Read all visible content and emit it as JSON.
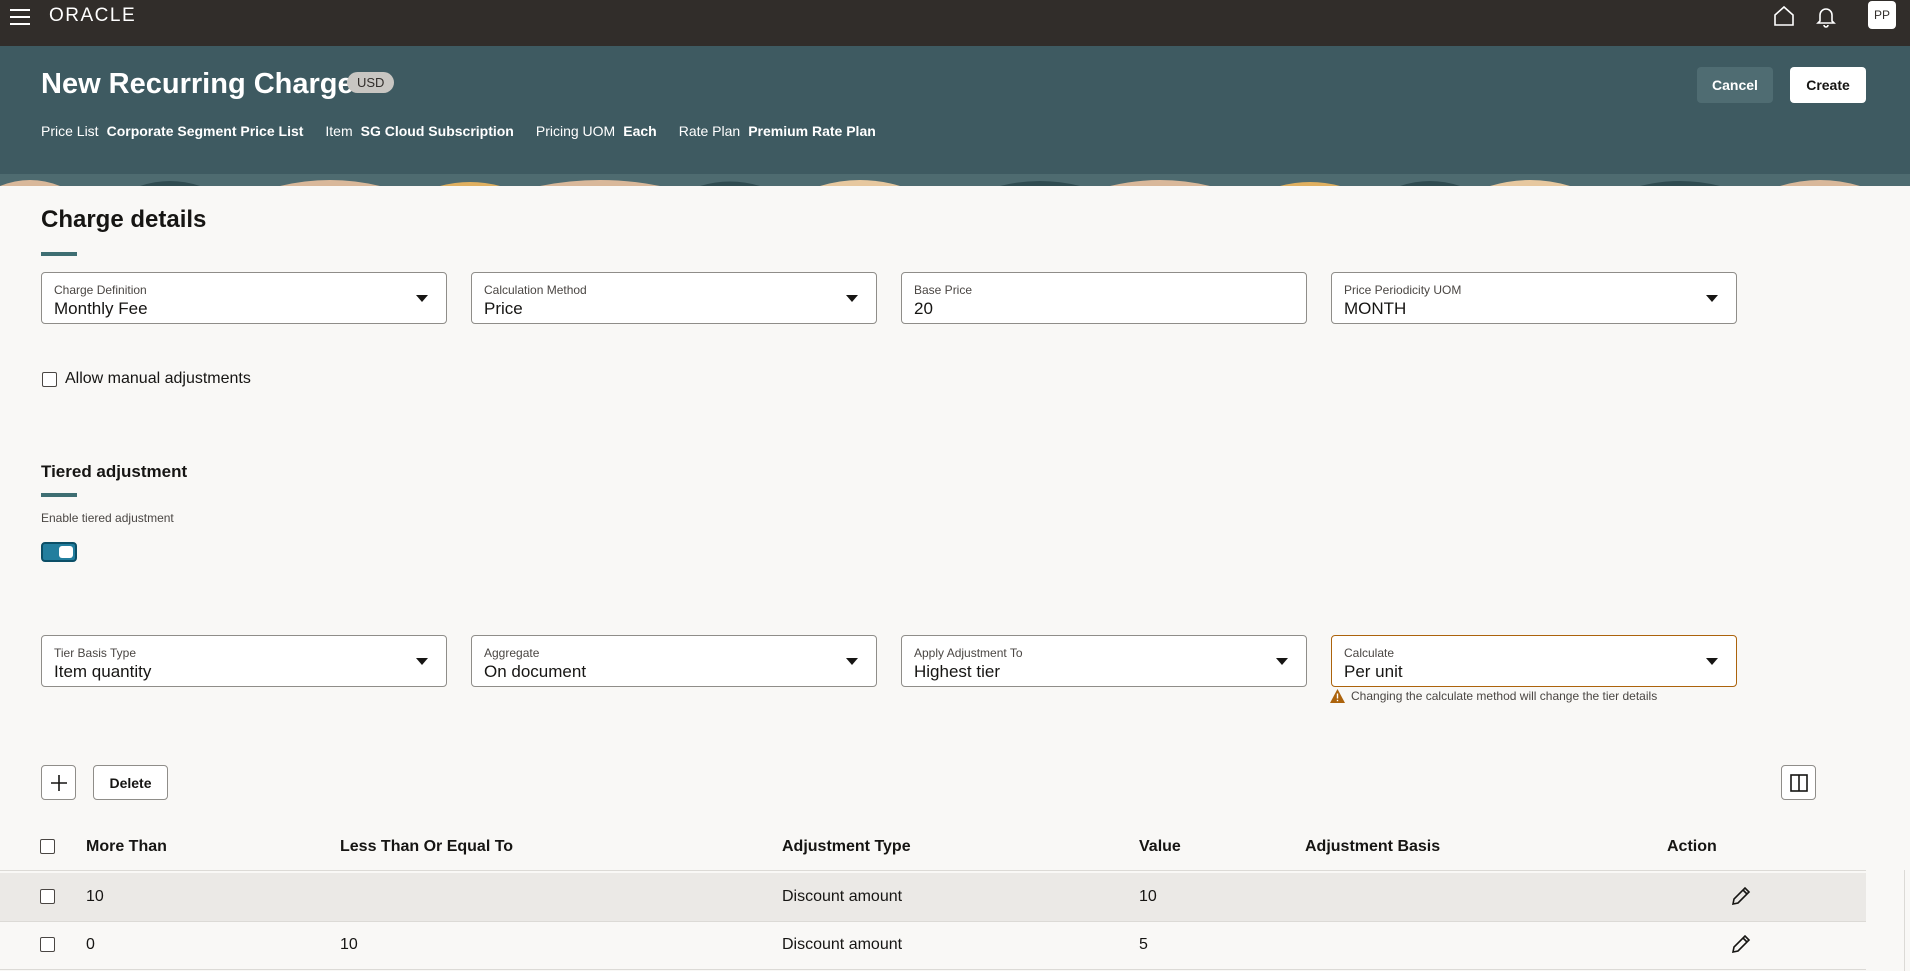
{
  "app": {
    "logo": "ORACLE",
    "avatar_initials": "PP"
  },
  "header": {
    "title": "New Recurring Charge",
    "currency": "USD",
    "meta": [
      {
        "label": "Price List",
        "value": "Corporate Segment Price List"
      },
      {
        "label": "Item",
        "value": "SG Cloud Subscription"
      },
      {
        "label": "Pricing UOM",
        "value": "Each"
      },
      {
        "label": "Rate Plan",
        "value": "Premium Rate Plan"
      }
    ],
    "cancel_label": "Cancel",
    "create_label": "Create"
  },
  "charge_details": {
    "title": "Charge details",
    "fields": [
      {
        "label": "Charge Definition",
        "value": "Monthly Fee"
      },
      {
        "label": "Calculation Method",
        "value": "Price"
      },
      {
        "label": "Base Price",
        "value": "20"
      },
      {
        "label": "Price Periodicity UOM",
        "value": "MONTH"
      }
    ],
    "manual_adjustments_label": "Allow manual adjustments"
  },
  "tiered": {
    "title": "Tiered adjustment",
    "enable_label": "Enable tiered adjustment",
    "fields": [
      {
        "label": "Tier Basis Type",
        "value": "Item quantity"
      },
      {
        "label": "Aggregate",
        "value": "On document"
      },
      {
        "label": "Apply Adjustment To",
        "value": "Highest tier"
      },
      {
        "label": "Calculate",
        "value": "Per unit"
      }
    ],
    "warning": "Changing the calculate method will change the tier details"
  },
  "toolbar": {
    "delete_label": "Delete"
  },
  "table": {
    "headers": [
      "More Than",
      "Less Than Or Equal To",
      "Adjustment Type",
      "Value",
      "Adjustment Basis",
      "Action"
    ],
    "rows": [
      {
        "more_than": "10",
        "less_than": "",
        "type": "Discount amount",
        "value": "10",
        "basis": ""
      },
      {
        "more_than": "0",
        "less_than": "10",
        "type": "Discount amount",
        "value": "5",
        "basis": ""
      }
    ]
  },
  "colors": {
    "topbar": "#312d2a",
    "header": "#3e5a61",
    "accent": "#227e9e",
    "warning": "#ac630c"
  },
  "icons": [
    "menu-icon",
    "home-icon",
    "bell-icon",
    "plus-icon",
    "columns-icon",
    "pencil-icon",
    "warning-icon"
  ]
}
